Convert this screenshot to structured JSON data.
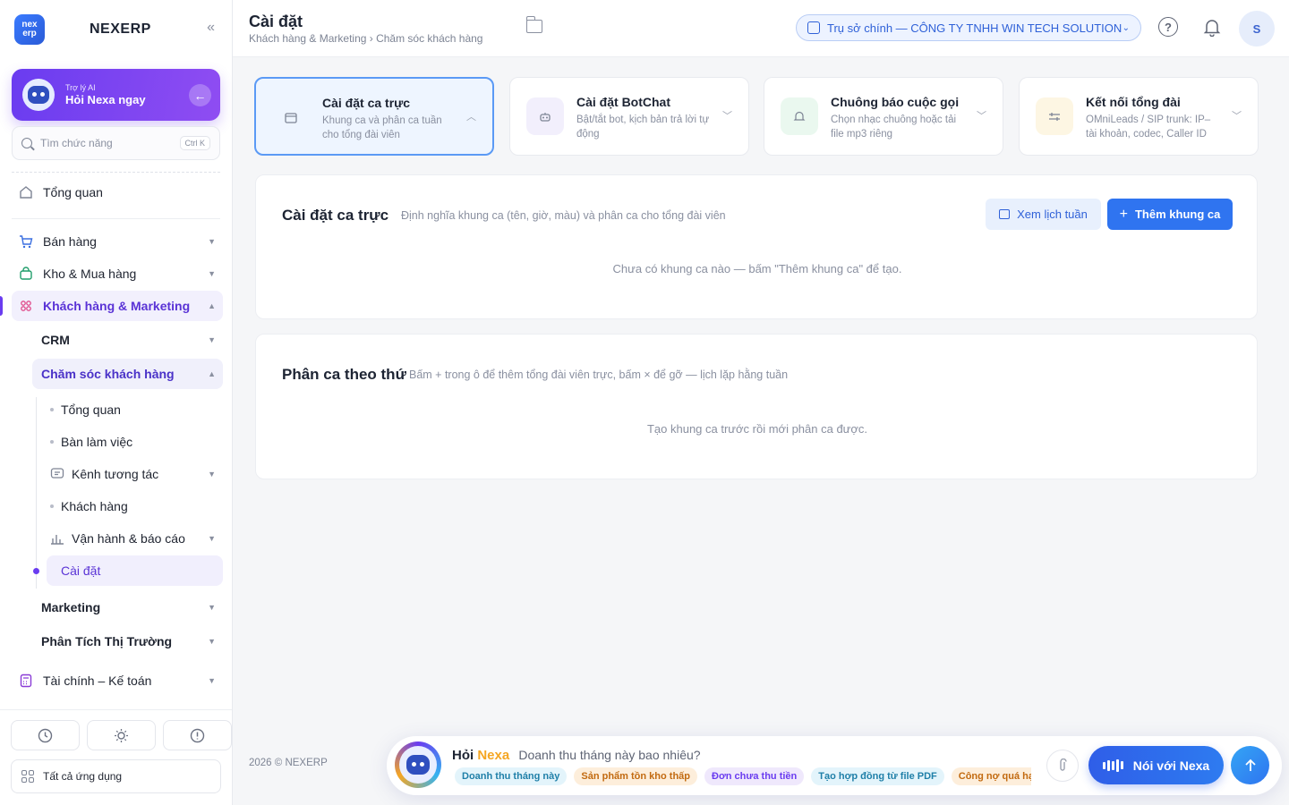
{
  "brand": {
    "logo_text": "nex erp",
    "name": "NEXERP",
    "collapse_icon": "«"
  },
  "ai_card": {
    "sub": "Trợ lý AI",
    "title": "Hỏi Nexa ngay"
  },
  "search": {
    "placeholder": "Tìm chức năng",
    "shortcut": "Ctrl K"
  },
  "nav": {
    "overview": "Tổng quan",
    "sales": "Bán hàng",
    "warehouse": "Kho & Mua hàng",
    "crm_marketing": "Khách hàng & Marketing",
    "crm": "CRM",
    "customer_care": "Chăm sóc khách hàng",
    "cc_overview": "Tổng quan",
    "cc_desk": "Bàn làm việc",
    "cc_channels": "Kênh tương tác",
    "cc_customers": "Khách hàng",
    "cc_ops": "Vận hành & báo cáo",
    "cc_settings": "Cài đặt",
    "marketing": "Marketing",
    "market_analysis": "Phân Tích Thị Trường",
    "finance": "Tài chính – Kế toán",
    "all_apps": "Tất cả ứng dụng"
  },
  "header": {
    "title": "Cài đặt",
    "breadcrumb": "Khách hàng & Marketing › Chăm sóc khách hàng",
    "org": "Trụ sở chính — CÔNG TY TNHH WIN TECH SOLUTION",
    "help": "?",
    "user_initial": "S"
  },
  "setting_cards": [
    {
      "title": "Cài đặt ca trực",
      "desc": "Khung ca và phân ca tuần cho tổng đài viên",
      "icon": "calendar-icon",
      "color": "#eef5ff",
      "selected": true
    },
    {
      "title": "Cài đặt BotChat",
      "desc": "Bật/tắt bot, kịch bản trả lời tự động",
      "icon": "bot-icon",
      "color": "#f2effc"
    },
    {
      "title": "Chuông báo cuộc gọi",
      "desc": "Chọn nhạc chuông hoặc tải file mp3 riêng",
      "icon": "bell-icon",
      "color": "#eaf8ef"
    },
    {
      "title": "Kết nối tổng đài",
      "desc": "OMniLeads / SIP trunk: IP–tài khoản, codec, Caller ID",
      "icon": "plug-icon",
      "color": "#fdf6e3"
    }
  ],
  "shift_panel": {
    "title": "Cài đặt ca trực",
    "desc": "Định nghĩa khung ca (tên, giờ, màu) và phân ca cho tổng đài viên",
    "view_week": "Xem lịch tuần",
    "add_shift": "Thêm khung ca",
    "empty": "Chưa có khung ca nào — bấm \"Thêm khung ca\" để tạo."
  },
  "weekday_panel": {
    "title": "Phân ca theo thứ",
    "desc": "Bấm + trong ô để thêm tổng đài viên trực, bấm × để gỡ — lịch lặp hằng tuần",
    "empty": "Tạo khung ca trước rồi mới phân ca được."
  },
  "footer": {
    "copyright": "2026 © NEXERP"
  },
  "chat": {
    "hoi": "Hỏi",
    "nexa": "Nexa",
    "question": "Doanh thu tháng này bao nhiêu?",
    "chips": [
      {
        "label": "Doanh thu tháng này",
        "bg": "#e3f4fb",
        "fg": "#1f7fa8"
      },
      {
        "label": "Sản phẩm tồn kho thấp",
        "bg": "#fdeedb",
        "fg": "#c26a10"
      },
      {
        "label": "Đơn chưa thu tiền",
        "bg": "#efe8fc",
        "fg": "#6a3cf0"
      },
      {
        "label": "Tạo hợp đồng từ file PDF",
        "bg": "#e3f4fb",
        "fg": "#1f7fa8"
      },
      {
        "label": "Công nợ quá hạn",
        "bg": "#fdeedb",
        "fg": "#c26a10"
      }
    ],
    "talk": "Nói với Nexa"
  }
}
